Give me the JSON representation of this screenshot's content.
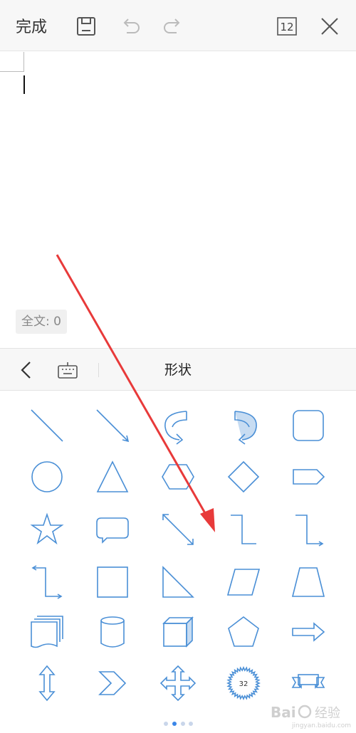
{
  "toolbar": {
    "done_label": "完成",
    "page_number": "12",
    "icons": [
      "save-icon",
      "undo-icon",
      "redo-icon",
      "page-view-icon",
      "close-icon"
    ]
  },
  "editor": {
    "word_count": "全文: 0"
  },
  "panel": {
    "title": "形状",
    "back_icon": "chevron-left-icon",
    "keyboard_icon": "keyboard-icon"
  },
  "shapes": [
    "line",
    "arrow-line",
    "curved-arrow-left",
    "curved-arrow-right",
    "rounded-rectangle",
    "oval",
    "triangle",
    "hexagon",
    "diamond",
    "pentagon-arrow",
    "star",
    "speech-bubble",
    "double-arrow-line",
    "elbow-connector",
    "elbow-arrow-connector",
    "elbow-double-arrow-connector",
    "rectangle",
    "right-triangle",
    "parallelogram",
    "trapezoid",
    "multi-document",
    "cylinder",
    "cube",
    "pentagon",
    "right-arrow",
    "up-down-arrow",
    "chevron",
    "four-way-arrow",
    "seal",
    "ribbon"
  ],
  "seal_label": "32",
  "pager": {
    "count": 4,
    "active": 1
  },
  "colors": {
    "shape_stroke": "#4a8fd6",
    "annotation_arrow": "#e83a3a",
    "toolbar_bg": "#f7f7f7"
  },
  "watermark_text": "Bai 经验",
  "watermark_sub": "jingyan.baidu.com"
}
